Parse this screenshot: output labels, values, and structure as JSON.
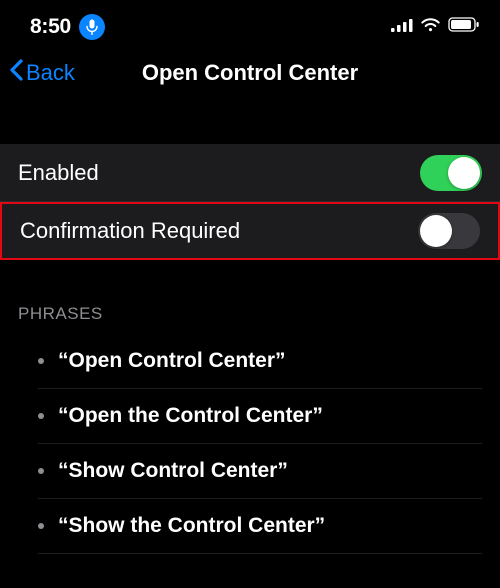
{
  "statusBar": {
    "time": "8:50"
  },
  "nav": {
    "backLabel": "Back",
    "title": "Open Control Center"
  },
  "rows": {
    "enabled": {
      "label": "Enabled",
      "on": true
    },
    "confirmation": {
      "label": "Confirmation Required",
      "on": false
    }
  },
  "sections": {
    "phrasesHeader": "PHRASES"
  },
  "phrases": [
    "“Open Control Center”",
    "“Open the Control Center”",
    "“Show Control Center”",
    "“Show the Control Center”"
  ]
}
